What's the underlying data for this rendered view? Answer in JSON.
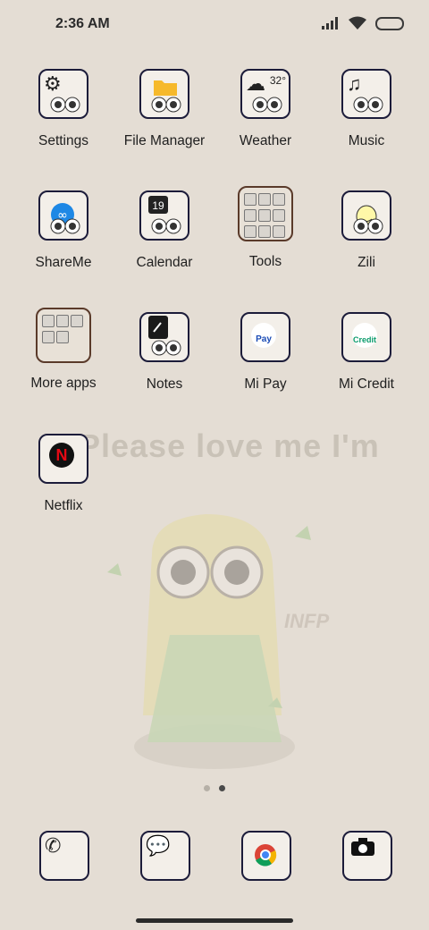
{
  "status_bar": {
    "time": "2:36 AM"
  },
  "wallpaper": {
    "text": "Please love me I'm",
    "tag": "INFP"
  },
  "apps": [
    {
      "label": "Settings",
      "icon": "gear-icon"
    },
    {
      "label": "File Manager",
      "icon": "folder-icon"
    },
    {
      "label": "Weather",
      "icon": "cloud-icon",
      "badge": "32°"
    },
    {
      "label": "Music",
      "icon": "music-note-icon"
    },
    {
      "label": "ShareMe",
      "icon": "infinity-icon"
    },
    {
      "label": "Calendar",
      "icon": "calendar-icon",
      "badge": "19"
    },
    {
      "label": "Tools",
      "icon": "folder-grid-icon"
    },
    {
      "label": "Zili",
      "icon": "smile-icon"
    },
    {
      "label": "More apps",
      "icon": "folder-grid-icon"
    },
    {
      "label": "Notes",
      "icon": "note-icon"
    },
    {
      "label": "Mi Pay",
      "icon": "mi-pay-icon",
      "badge": "Pay"
    },
    {
      "label": "Mi Credit",
      "icon": "mi-credit-icon",
      "badge": "Credit"
    },
    {
      "label": "Netflix",
      "icon": "netflix-icon",
      "badge": "N"
    }
  ],
  "dock": [
    {
      "icon": "phone-icon"
    },
    {
      "icon": "messages-icon"
    },
    {
      "icon": "chrome-icon"
    },
    {
      "icon": "camera-icon"
    }
  ],
  "colors": {
    "background": "#e4ddd4",
    "tile_border": "#1c1c3a",
    "netflix_red": "#e50914"
  }
}
